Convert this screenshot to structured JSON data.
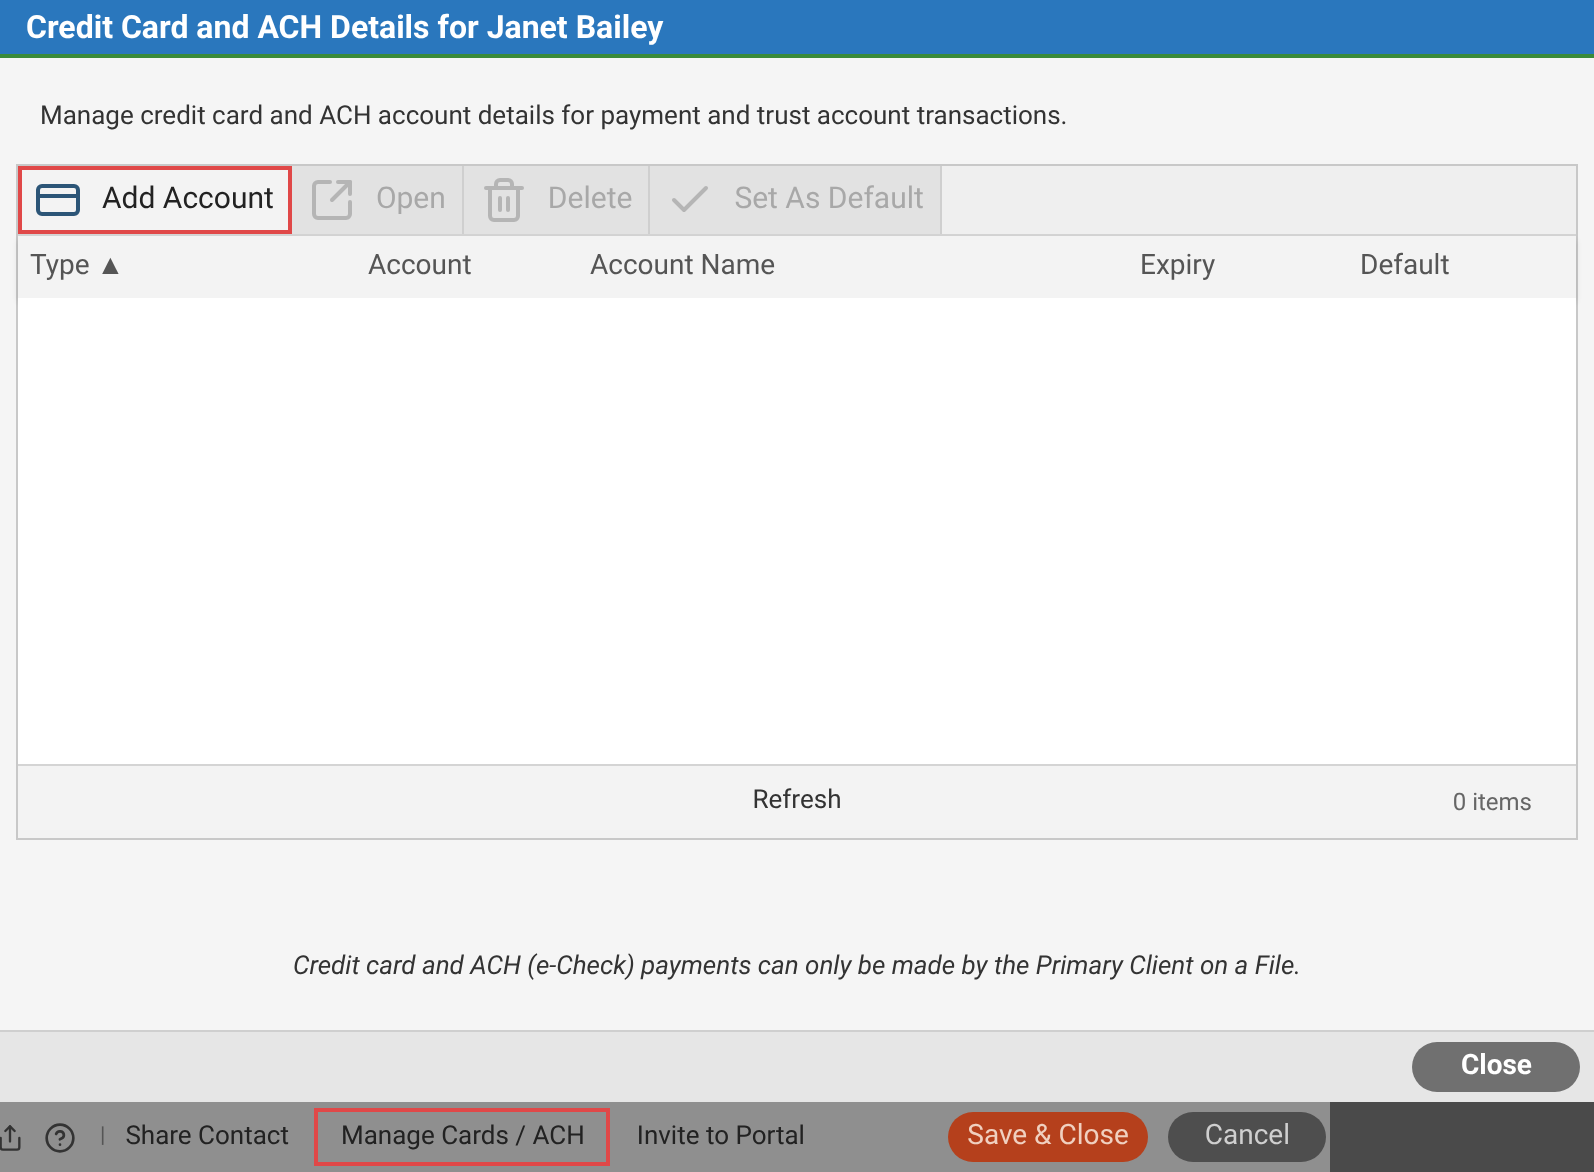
{
  "dialog": {
    "title": "Credit Card and ACH Details for Janet Bailey",
    "intro": "Manage credit card and ACH account details for payment and trust account transactions."
  },
  "toolbar": [
    {
      "kind": "card",
      "label": "Add Account",
      "disabled": false,
      "highlighted": true
    },
    {
      "kind": "open",
      "label": "Open",
      "disabled": true,
      "highlighted": false
    },
    {
      "kind": "trash",
      "label": "Delete",
      "disabled": true,
      "highlighted": false
    },
    {
      "kind": "check",
      "label": "Set As Default",
      "disabled": true,
      "highlighted": false
    }
  ],
  "table": {
    "columns": [
      {
        "label": "Type",
        "sort": "▲"
      },
      {
        "label": "Account"
      },
      {
        "label": "Account Name"
      },
      {
        "label": "Expiry"
      },
      {
        "label": "Default"
      }
    ],
    "footer": {
      "refresh": "Refresh",
      "count": "0 items"
    }
  },
  "note": "Credit card and ACH (e-Check) payments can only be made by the Primary Client on a File.",
  "close_button": "Close",
  "background_bar": {
    "separator": "|",
    "links": [
      {
        "label": "Share Contact",
        "highlighted": false
      },
      {
        "label": "Manage Cards / ACH",
        "highlighted": true
      },
      {
        "label": "Invite to Portal",
        "highlighted": false
      }
    ],
    "save_button": "Save & Close",
    "cancel_button": "Cancel"
  }
}
